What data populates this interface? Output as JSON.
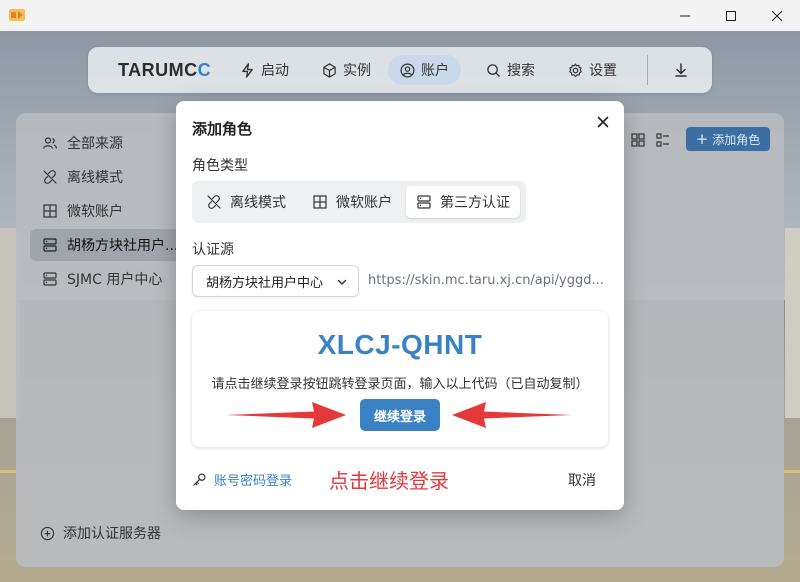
{
  "nav": {
    "brand_main": "TARUMC",
    "brand_accent": "C",
    "items": [
      {
        "label": "启动"
      },
      {
        "label": "实例"
      },
      {
        "label": "账户"
      },
      {
        "label": "搜索"
      },
      {
        "label": "设置"
      }
    ]
  },
  "sidebar": {
    "items": [
      {
        "label": "全部来源"
      },
      {
        "label": "离线模式"
      },
      {
        "label": "微软账户"
      },
      {
        "label": "胡杨方块社用户..."
      },
      {
        "label": "SJMC 用户中心"
      }
    ],
    "add_server": "添加认证服务器"
  },
  "toolbar": {
    "add_role": "添加角色"
  },
  "dialog": {
    "title": "添加角色",
    "role_type_label": "角色类型",
    "role_types": [
      {
        "label": "离线模式"
      },
      {
        "label": "微软账户"
      },
      {
        "label": "第三方认证"
      }
    ],
    "auth_source_label": "认证源",
    "auth_source_value": "胡杨方块社用户中心",
    "auth_url": "https://skin.mc.taru.xj.cn/api/yggd...",
    "device_code": "XLCJ-QHNT",
    "hint": "请点击继续登录按钮跳转登录页面，输入以上代码（已自动复制）",
    "continue_label": "继续登录",
    "password_login": "账号密码登录",
    "annotation": "点击继续登录",
    "cancel_label": "取消"
  },
  "colors": {
    "accent": "#3b82c4",
    "annotation_red": "#e5383b"
  }
}
